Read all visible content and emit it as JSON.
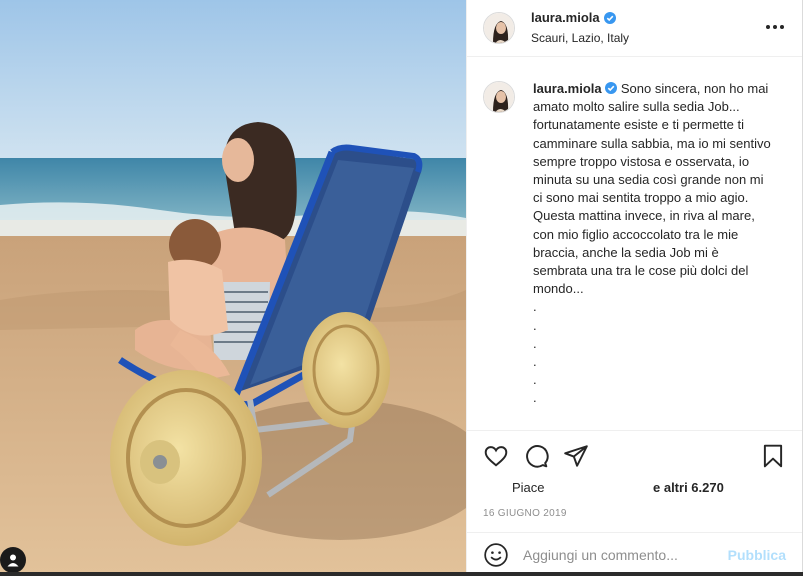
{
  "post": {
    "username": "laura.miola",
    "location": "Scauri, Lazio, Italy",
    "caption_lines": [
      "Sono sincera, non ho mai amato molto salire sulla sedia Job... fortunatamente esiste e ti permette ti camminare sulla sabbia, ma io mi sentivo sempre troppo vistosa e osservata, io minuta su una sedia così grande non mi ci sono mai sentita troppo a mio agio.",
      "Questa mattina invece, in riva al mare, con mio figlio accoccolato tra le mie braccia, anche la sedia Job mi è sembrata una tra le cose più dolci del mondo..."
    ],
    "dots": [
      ".",
      ".",
      ".",
      ".",
      ".",
      "."
    ],
    "likes_prefix": "Piace",
    "likes_suffix": "e altri 6.270",
    "date": "16 GIUGNO 2019"
  },
  "comment": {
    "placeholder": "Aggiungi un commento...",
    "publish_label": "Pubblica"
  },
  "icons": {
    "verified": "verified-badge-icon",
    "more": "more-options-icon",
    "like": "heart-icon",
    "comment": "comment-icon",
    "share": "share-icon",
    "save": "bookmark-icon",
    "emoji": "emoji-icon"
  },
  "colors": {
    "verified": "#3897f0",
    "publish_disabled": "#b2dffc",
    "muted_text": "#8e8e8e"
  }
}
